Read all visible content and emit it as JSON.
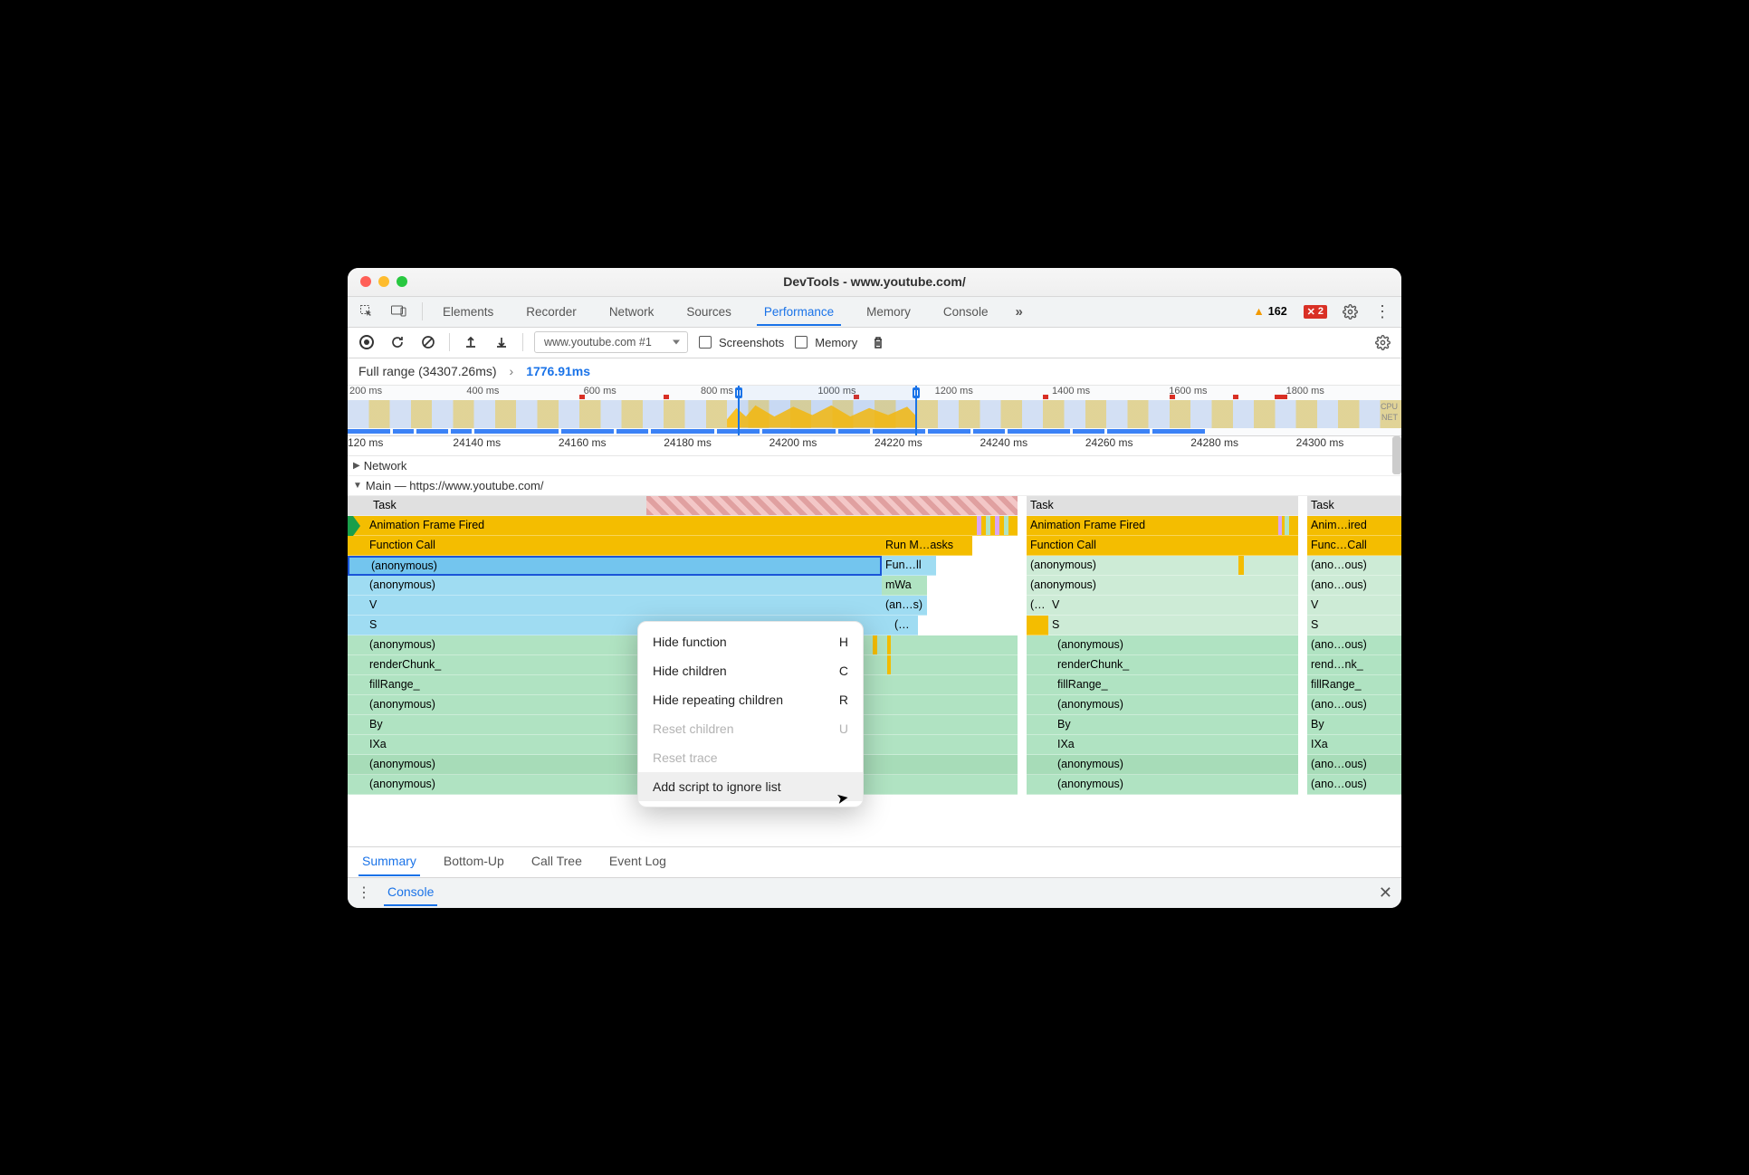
{
  "window": {
    "title": "DevTools - www.youtube.com/"
  },
  "tabs": {
    "items": [
      "Elements",
      "Recorder",
      "Network",
      "Sources",
      "Performance",
      "Memory",
      "Console"
    ],
    "active_index": 4,
    "overflow_glyph": "»",
    "warning_count": "162",
    "error_count": "2"
  },
  "toolbar": {
    "select_label": "www.youtube.com #1",
    "cb_screenshots": "Screenshots",
    "cb_memory": "Memory"
  },
  "breadcrumb": {
    "full_range": "Full range (34307.26ms)",
    "selected": "1776.91ms"
  },
  "overview": {
    "ticks": [
      "200 ms",
      "400 ms",
      "600 ms",
      "800 ms",
      "1000 ms",
      "1200 ms",
      "1400 ms",
      "1600 ms",
      "1800 ms"
    ],
    "right_labels": [
      "CPU",
      "NET"
    ]
  },
  "detail_ruler": [
    "120 ms",
    "24140 ms",
    "24160 ms",
    "24180 ms",
    "24200 ms",
    "24220 ms",
    "24240 ms",
    "24260 ms",
    "24280 ms",
    "24300 ms"
  ],
  "sections": {
    "network": "Network",
    "main": "Main — https://www.youtube.com/"
  },
  "flame": {
    "col1": {
      "task": "Task",
      "afire": "Animation Frame Fired",
      "func": "Function Call",
      "runm": "Run M…asks",
      "anon_sel": "(anonymous)",
      "funll": "Fun…ll",
      "anon2": "(anonymous)",
      "mwa": "mWa",
      "v": "V",
      "ans": "(an…s)",
      "s": "S",
      "paren": "(…",
      "anon3": "(anonymous)",
      "renderchunk": "renderChunk_",
      "fillrange": "fillRange_",
      "anon4": "(anonymous)",
      "by": "By",
      "ixa": "IXa",
      "anon5": "(anonymous)",
      "anon6": "(anonymous)"
    },
    "col2": {
      "task": "Task",
      "afire": "Animation Frame Fired",
      "func": "Function Call",
      "anon": "(anonymous)",
      "anon2": "(anonymous)",
      "ell": "(…",
      "v": "V",
      "s": "S",
      "anon3": "(anonymous)",
      "renderchunk": "renderChunk_",
      "fillrange": "fillRange_",
      "anon4": "(anonymous)",
      "by": "By",
      "ixa": "IXa",
      "anon5": "(anonymous)",
      "anon6": "(anonymous)"
    },
    "col3": {
      "task": "Task",
      "afire": "Anim…ired",
      "func": "Func…Call",
      "anon": "(ano…ous)",
      "anon2": "(ano…ous)",
      "v": "V",
      "s": "S",
      "anon3": "(ano…ous)",
      "renderchunk": "rend…nk_",
      "fillrange": "fillRange_",
      "anon4": "(ano…ous)",
      "by": "By",
      "ixa": "IXa",
      "anon5": "(ano…ous)",
      "anon6": "(ano…ous)"
    }
  },
  "bottom_tabs": {
    "items": [
      "Summary",
      "Bottom-Up",
      "Call Tree",
      "Event Log"
    ],
    "active_index": 0
  },
  "drawer": {
    "console": "Console"
  },
  "context_menu": {
    "items": [
      {
        "label": "Hide function",
        "shortcut": "H",
        "disabled": false,
        "hover": false
      },
      {
        "label": "Hide children",
        "shortcut": "C",
        "disabled": false,
        "hover": false
      },
      {
        "label": "Hide repeating children",
        "shortcut": "R",
        "disabled": false,
        "hover": false
      },
      {
        "label": "Reset children",
        "shortcut": "U",
        "disabled": true,
        "hover": false
      },
      {
        "label": "Reset trace",
        "shortcut": "",
        "disabled": true,
        "hover": false
      },
      {
        "label": "Add script to ignore list",
        "shortcut": "",
        "disabled": false,
        "hover": true
      }
    ]
  }
}
